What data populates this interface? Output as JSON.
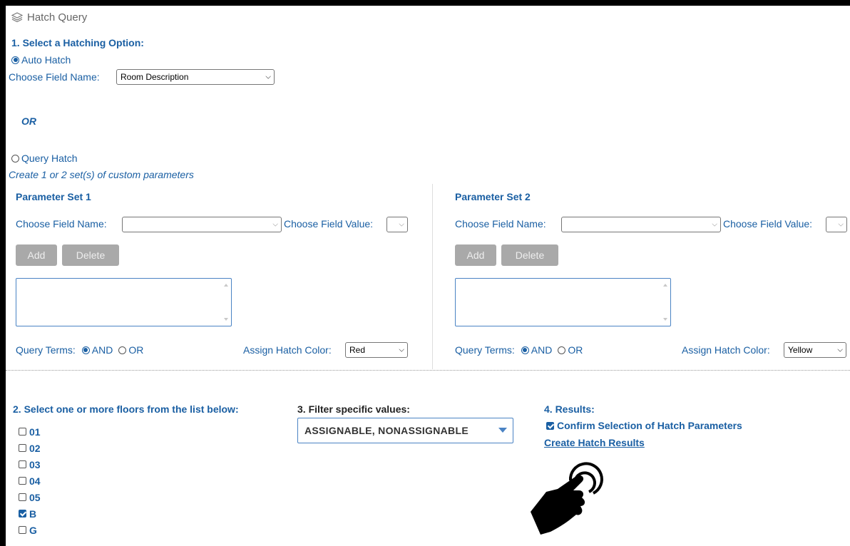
{
  "header": {
    "title": "Hatch Query",
    "icon": "layers-icon"
  },
  "step1": {
    "heading": "1. Select a Hatching Option:",
    "auto_hatch": {
      "label": "Auto Hatch",
      "selected": true
    },
    "choose_field_label": "Choose Field Name:",
    "choose_field_value": "Room Description",
    "or_text": "OR",
    "query_hatch": {
      "label": "Query Hatch",
      "selected": false
    },
    "query_hint": "Create 1 or 2 set(s) of custom parameters"
  },
  "param_sets": [
    {
      "title": "Parameter Set 1",
      "field_name_label": "Choose Field Name:",
      "field_name_value": "",
      "field_value_label": "Choose Field Value:",
      "field_value_value": "",
      "add_label": "Add",
      "delete_label": "Delete",
      "query_terms_label": "Query Terms:",
      "and_label": "AND",
      "or_label": "OR",
      "and_selected": true,
      "hatch_color_label": "Assign Hatch Color:",
      "hatch_color_value": "Red"
    },
    {
      "title": "Parameter Set 2",
      "field_name_label": "Choose Field Name:",
      "field_name_value": "",
      "field_value_label": "Choose Field Value:",
      "field_value_value": "",
      "add_label": "Add",
      "delete_label": "Delete",
      "query_terms_label": "Query Terms:",
      "and_label": "AND",
      "or_label": "OR",
      "and_selected": true,
      "hatch_color_label": "Assign Hatch Color:",
      "hatch_color_value": "Yellow"
    }
  ],
  "step2": {
    "heading": "2. Select one or more floors from the list below:",
    "floors": [
      {
        "label": "01",
        "checked": false
      },
      {
        "label": "02",
        "checked": false
      },
      {
        "label": "03",
        "checked": false
      },
      {
        "label": "04",
        "checked": false
      },
      {
        "label": "05",
        "checked": false
      },
      {
        "label": "B",
        "checked": true
      },
      {
        "label": "G",
        "checked": false
      }
    ]
  },
  "step3": {
    "heading": "3. Filter specific values:",
    "filter_value": "ASSIGNABLE, NONASSIGNABLE"
  },
  "step4": {
    "heading": "4. Results:",
    "confirm_label": "Confirm Selection of Hatch Parameters",
    "confirm_checked": true,
    "create_link": "Create Hatch Results"
  },
  "overlay": {
    "icon": "pointing-hand-icon"
  },
  "colors": {
    "accent": "#1a5fa3",
    "button_disabled": "#a9a9a9",
    "field_border": "#4a83c4"
  }
}
